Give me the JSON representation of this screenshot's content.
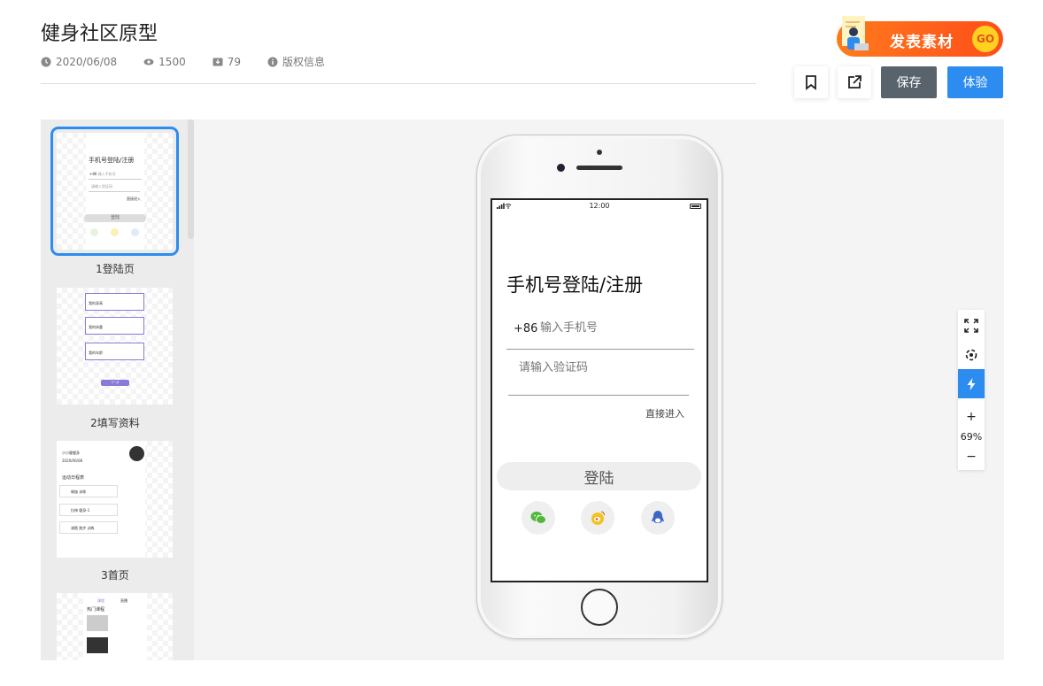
{
  "header": {
    "title": "健身社区原型",
    "date": "2020/06/08",
    "views": "1500",
    "downloads": "79",
    "copyright": "版权信息"
  },
  "promo": {
    "text": "发表素材",
    "go": "GO"
  },
  "toolbar": {
    "save_label": "保存",
    "try_label": "体验"
  },
  "sidebar": {
    "pages": [
      {
        "label": "1登陆页",
        "active": true
      },
      {
        "label": "2填写资料",
        "active": false
      },
      {
        "label": "3首页",
        "active": false
      },
      {
        "label": "",
        "active": false
      }
    ],
    "thumb1": {
      "title": "手机号登陆/注册",
      "cc": "+86",
      "phone": "输入手机号",
      "code": "请输入验证码",
      "direct": "直接进入",
      "btn": "登陆"
    },
    "thumb2": {
      "row1": "我的身高",
      "row2": "我的体重",
      "row3": "我的年龄",
      "next": "下一步"
    },
    "thumb3": {
      "name": "小小健健身",
      "date": "2020/06/08",
      "section": "运动日程表",
      "item1": "瑜伽 训练",
      "item2": "拉伸 健身-1",
      "item3": "减脂 跑步 训练"
    },
    "thumb4": {
      "tab1": "课程",
      "tab2": "直播",
      "heading": "热门课程"
    }
  },
  "screen": {
    "time": "12:00",
    "title": "手机号登陆/注册",
    "country_code": "+86",
    "phone_placeholder": "输入手机号",
    "code_placeholder": "请输入验证码",
    "direct_enter": "直接进入",
    "login_label": "登陆",
    "social": [
      "wechat-icon",
      "weibo-icon",
      "qq-icon"
    ]
  },
  "zoom": {
    "level": "69%",
    "plus": "+",
    "minus": "−"
  },
  "colors": {
    "accent": "#2d8cf0",
    "save_bg": "#59636b",
    "promo": "#ff5a1a"
  }
}
